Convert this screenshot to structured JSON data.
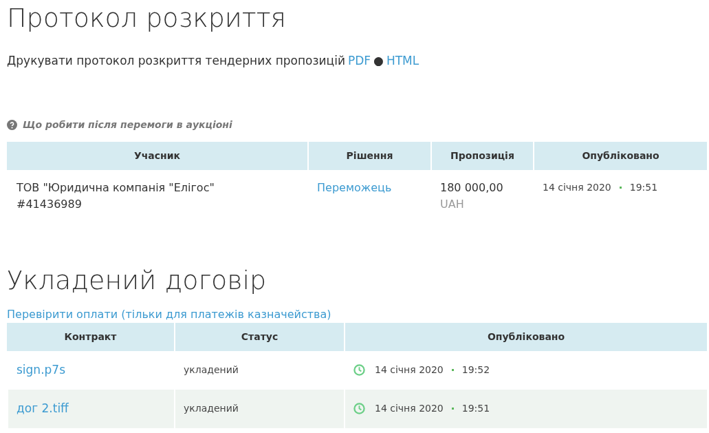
{
  "protocol": {
    "title": "Протокол розкриття",
    "print_text": "Друкувати протокол розкриття тендерних пропозицій",
    "print_links": [
      "PDF",
      "HTML"
    ],
    "separator": "●",
    "help_link": "Що робити після перемоги в аукціоні",
    "columns": [
      "Учасник",
      "Рішення",
      "Пропозиція",
      "Опубліковано"
    ],
    "rows": [
      {
        "participant": "ТОВ \"Юридична компанія \"Елігос\"",
        "code": "#41436989",
        "decision": "Переможець",
        "amount": "180 000,00",
        "currency": "UAH",
        "date": "14 січня 2020",
        "time": "19:51"
      }
    ]
  },
  "contract": {
    "title": "Укладений договір",
    "check_link": "Перевірити оплати (тільки для платежів казначейства)",
    "columns": [
      "Контракт",
      "Статус",
      "Опубліковано"
    ],
    "rows": [
      {
        "file": "sign.p7s",
        "status": "укладений",
        "date": "14 січня 2020",
        "time": "19:52"
      },
      {
        "file": "дог 2.tiff",
        "status": "укладений",
        "date": "14 січня 2020",
        "time": "19:51"
      }
    ]
  }
}
